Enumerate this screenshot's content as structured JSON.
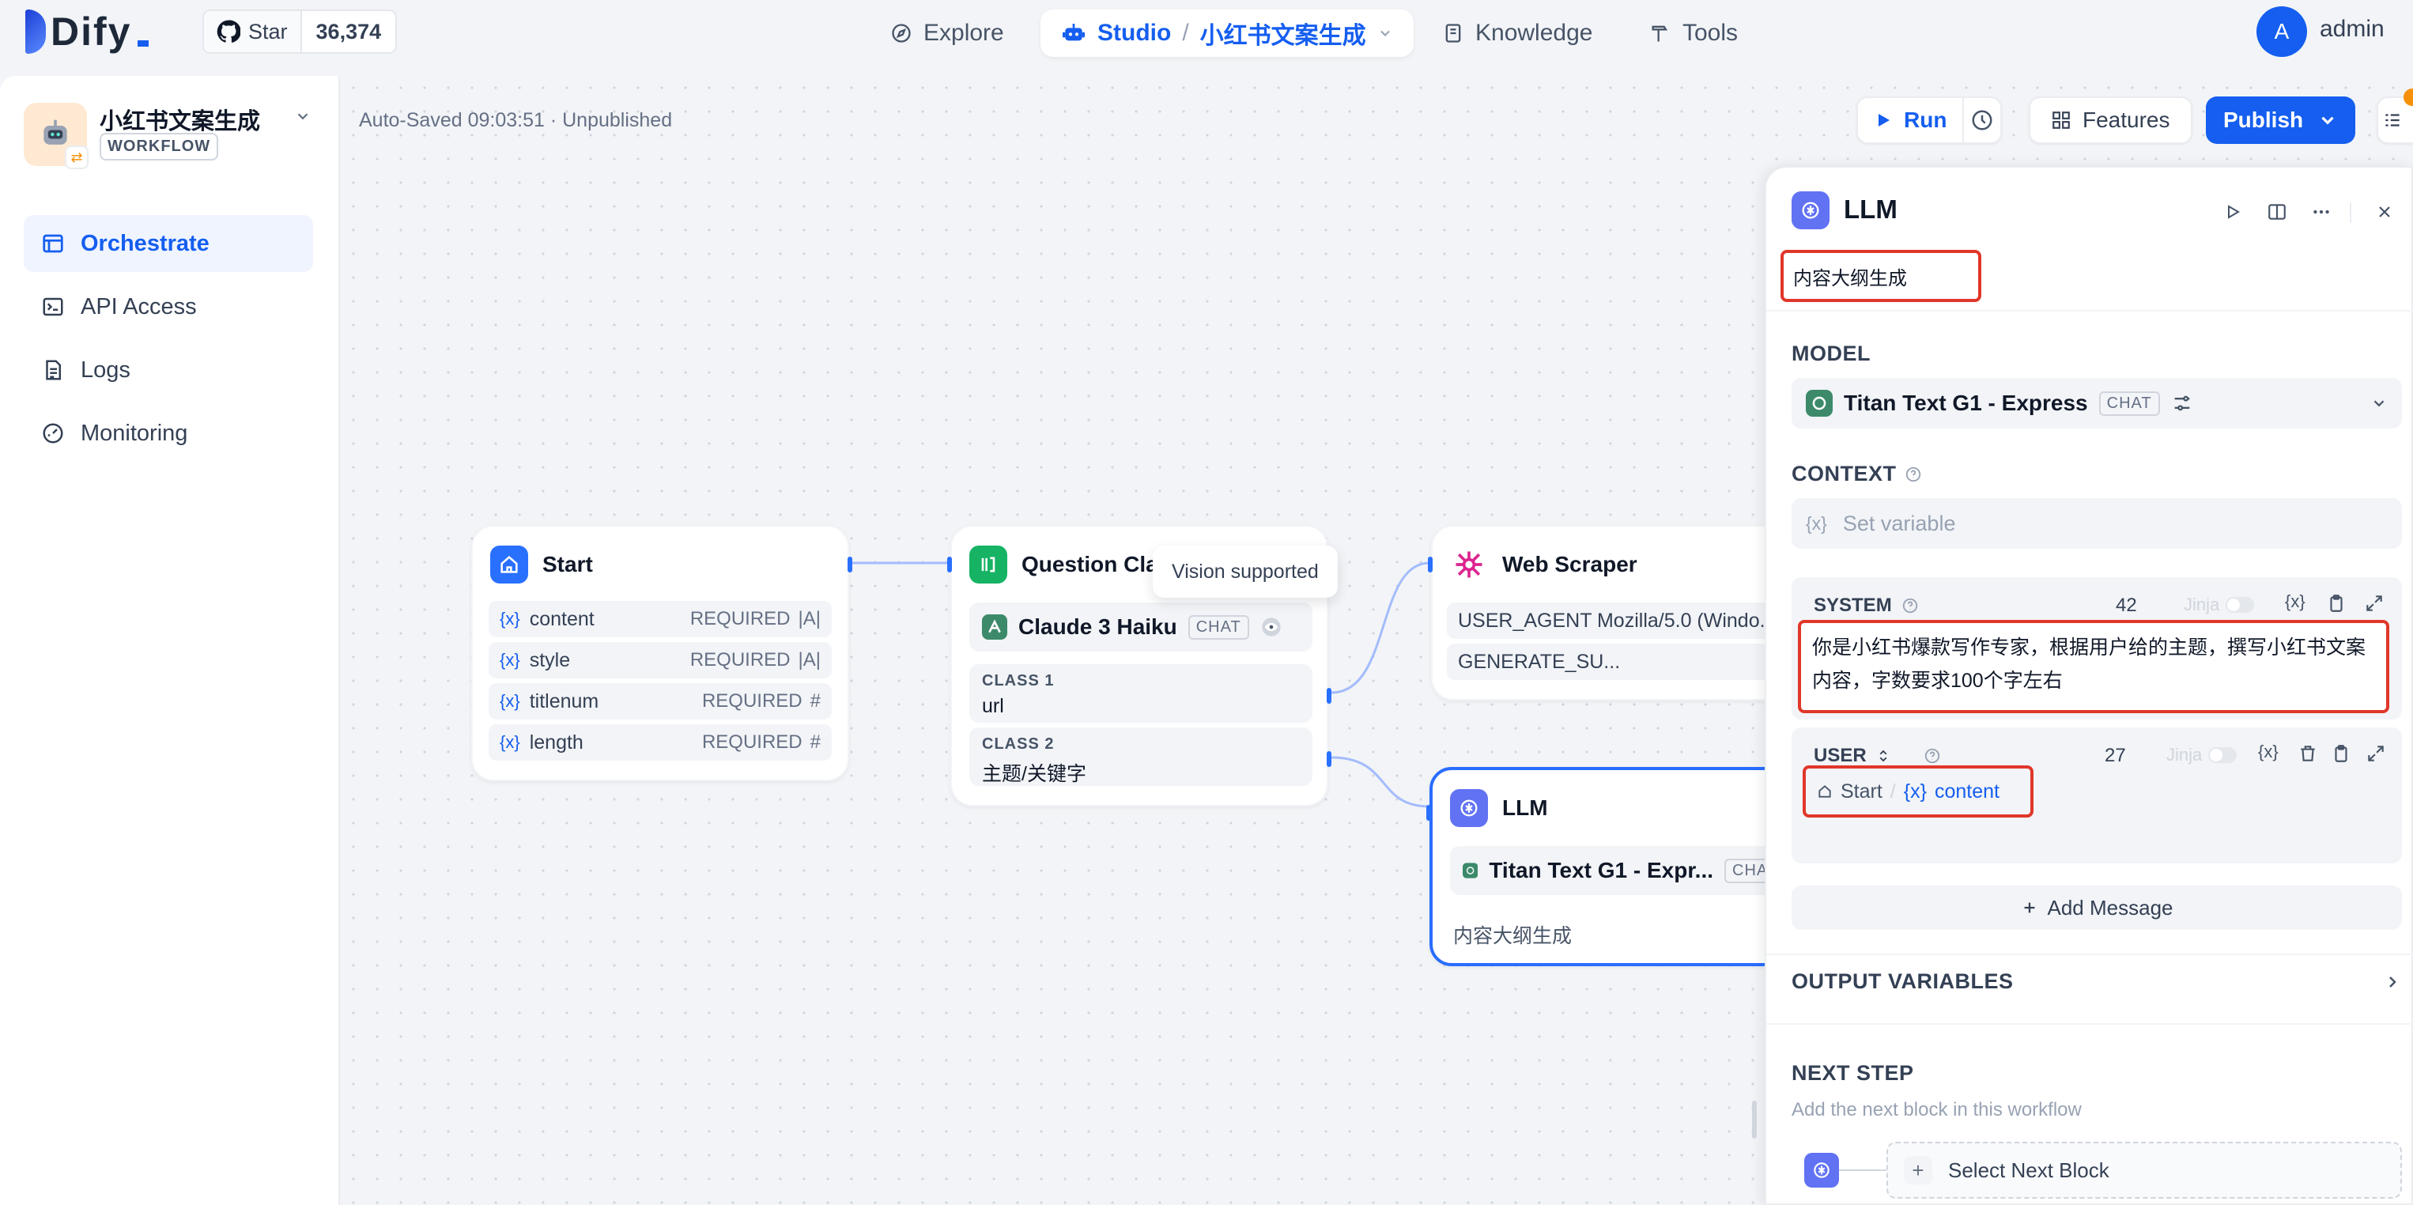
{
  "brand": {
    "name": "Dify"
  },
  "github": {
    "star_label": "Star",
    "count": "36,374"
  },
  "nav": {
    "explore": "Explore",
    "studio": "Studio",
    "app_name": "小红书文案生成",
    "knowledge": "Knowledge",
    "tools": "Tools"
  },
  "user": {
    "initial": "A",
    "name": "admin"
  },
  "sidebar": {
    "app_title": "小红书文案生成",
    "app_type": "WORKFLOW",
    "items": [
      {
        "label": "Orchestrate",
        "icon": "layout-icon",
        "active": true
      },
      {
        "label": "API Access",
        "icon": "terminal-icon"
      },
      {
        "label": "Logs",
        "icon": "file-list-icon"
      },
      {
        "label": "Monitoring",
        "icon": "dashboard-icon"
      }
    ]
  },
  "toolbar": {
    "status": "Auto-Saved 09:03:51 · Unpublished",
    "run": "Run",
    "features": "Features",
    "publish": "Publish"
  },
  "nodes": {
    "start": {
      "title": "Start",
      "vars": [
        {
          "name": "content",
          "req": "REQUIRED",
          "type": "text-icon"
        },
        {
          "name": "style",
          "req": "REQUIRED",
          "type": "text-icon"
        },
        {
          "name": "titlenum",
          "req": "REQUIRED",
          "type": "number-icon"
        },
        {
          "name": "length",
          "req": "REQUIRED",
          "type": "number-icon"
        }
      ]
    },
    "question_classifier": {
      "title": "Question Clas",
      "model": "Claude 3 Haiku",
      "model_tag": "CHAT",
      "tooltip": "Vision supported",
      "classes": [
        {
          "label": "CLASS 1",
          "value": "url"
        },
        {
          "label": "CLASS 2",
          "value": "主题/关键字"
        }
      ]
    },
    "web_scraper": {
      "title": "Web Scraper",
      "rows": [
        "USER_AGENT Mozilla/5.0 (Windo...",
        "GENERATE_SU..."
      ]
    },
    "llm": {
      "title": "LLM",
      "model": "Titan Text G1 - Expr...",
      "model_tag": "CHAT",
      "desc": "内容大纲生成"
    }
  },
  "panel": {
    "title": "LLM",
    "description": "内容大纲生成",
    "model_label": "MODEL",
    "model_name": "Titan Text G1 - Express",
    "model_tag": "CHAT",
    "context_label": "CONTEXT",
    "context_placeholder": "Set variable",
    "system": {
      "label": "SYSTEM",
      "count": "42",
      "jinja": "Jinja",
      "text": "你是小红书爆款写作专家，根据用户给的主题，撰写小红书文案内容，字数要求100个字左右"
    },
    "user": {
      "label": "USER",
      "count": "27",
      "jinja": "Jinja",
      "ref_node": "Start",
      "ref_sep": "/",
      "ref_var": "content"
    },
    "add_message": "Add Message",
    "output_vars": "OUTPUT VARIABLES",
    "next_step": "NEXT STEP",
    "next_desc": "Add the next block in this workflow",
    "select_next": "Select Next Block"
  },
  "colors": {
    "accent": "#155eef",
    "highlight_box": "#e0372a",
    "llm_icon": "#6172f3",
    "start_icon": "#2970ff",
    "classifier_icon": "#16b364",
    "scraper_icon": "#dd2590"
  }
}
